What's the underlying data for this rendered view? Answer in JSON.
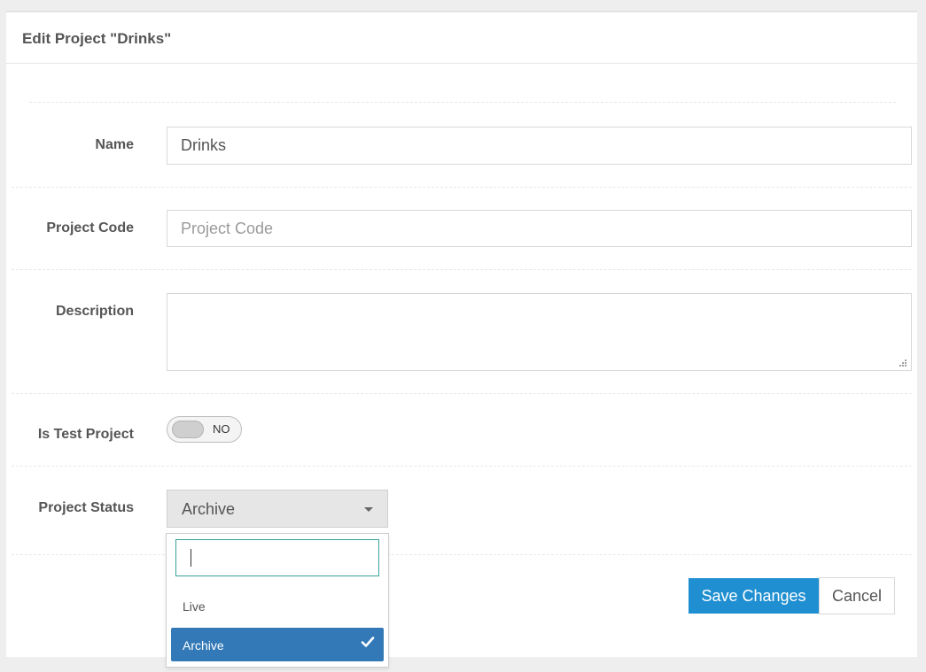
{
  "panel": {
    "title": "Edit Project \"Drinks\""
  },
  "form": {
    "name": {
      "label": "Name",
      "value": "Drinks"
    },
    "project_code": {
      "label": "Project Code",
      "value": "",
      "placeholder": "Project Code"
    },
    "description": {
      "label": "Description",
      "value": ""
    },
    "is_test_project": {
      "label": "Is Test Project",
      "state_text": "NO",
      "on": false
    },
    "project_status": {
      "label": "Project Status",
      "selected": "Archive",
      "options": [
        {
          "label": "Live",
          "selected": false
        },
        {
          "label": "Archive",
          "selected": true
        }
      ],
      "search_value": ""
    }
  },
  "actions": {
    "save_label": "Save Changes",
    "cancel_label": "Cancel"
  },
  "colors": {
    "primary": "#1f8fd1",
    "selected_option": "#3379b7",
    "search_border": "#3aa29a"
  },
  "icons": {
    "caret": "chevron-down-icon",
    "check": "check-icon",
    "resize": "resize-grip-icon"
  }
}
